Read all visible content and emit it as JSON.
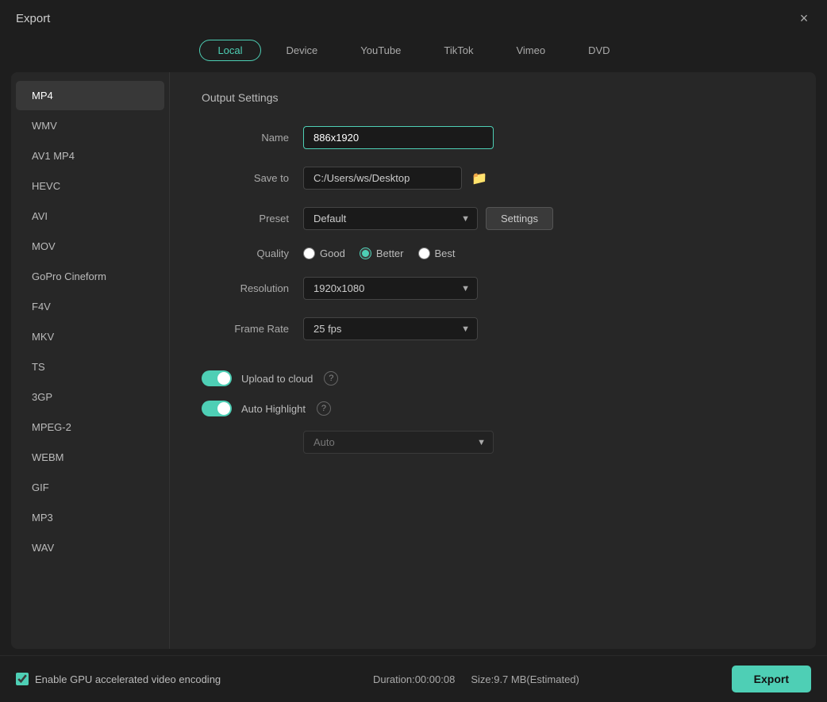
{
  "window": {
    "title": "Export",
    "close_label": "×"
  },
  "tabs": [
    {
      "label": "Local",
      "active": true
    },
    {
      "label": "Device",
      "active": false
    },
    {
      "label": "YouTube",
      "active": false
    },
    {
      "label": "TikTok",
      "active": false
    },
    {
      "label": "Vimeo",
      "active": false
    },
    {
      "label": "DVD",
      "active": false
    }
  ],
  "formats": [
    {
      "label": "MP4",
      "active": true
    },
    {
      "label": "WMV",
      "active": false
    },
    {
      "label": "AV1 MP4",
      "active": false
    },
    {
      "label": "HEVC",
      "active": false
    },
    {
      "label": "AVI",
      "active": false
    },
    {
      "label": "MOV",
      "active": false
    },
    {
      "label": "GoPro Cineform",
      "active": false
    },
    {
      "label": "F4V",
      "active": false
    },
    {
      "label": "MKV",
      "active": false
    },
    {
      "label": "TS",
      "active": false
    },
    {
      "label": "3GP",
      "active": false
    },
    {
      "label": "MPEG-2",
      "active": false
    },
    {
      "label": "WEBM",
      "active": false
    },
    {
      "label": "GIF",
      "active": false
    },
    {
      "label": "MP3",
      "active": false
    },
    {
      "label": "WAV",
      "active": false
    }
  ],
  "output_settings": {
    "section_title": "Output Settings",
    "name_label": "Name",
    "name_value": "886x1920",
    "save_to_label": "Save to",
    "save_to_path": "C:/Users/ws/Desktop",
    "preset_label": "Preset",
    "preset_value": "Default",
    "settings_btn_label": "Settings",
    "quality_label": "Quality",
    "quality_options": [
      {
        "label": "Good",
        "selected": false
      },
      {
        "label": "Better",
        "selected": true
      },
      {
        "label": "Best",
        "selected": false
      }
    ],
    "resolution_label": "Resolution",
    "resolution_value": "1920x1080",
    "frame_rate_label": "Frame Rate",
    "frame_rate_value": "25 fps",
    "upload_cloud_label": "Upload to cloud",
    "auto_highlight_label": "Auto Highlight",
    "auto_value": "Auto"
  },
  "bottom_bar": {
    "gpu_label": "Enable GPU accelerated video encoding",
    "duration_label": "Duration:00:00:08",
    "size_label": "Size:9.7 MB(Estimated)",
    "export_btn_label": "Export"
  }
}
